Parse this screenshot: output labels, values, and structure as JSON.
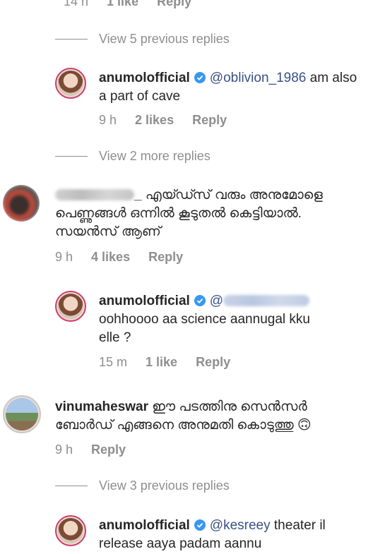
{
  "top_meta": {
    "time": "14 h",
    "likes": "1 like",
    "reply": "Reply"
  },
  "view_rows": {
    "r1": "View 5 previous replies",
    "r2": "View 2 more replies",
    "r3": "View 3 previous replies"
  },
  "comments": [
    {
      "username": "anumolofficial",
      "mention": "@oblivion_1986",
      "text": " am also a part of cave",
      "time": "9 h",
      "likes": "2 likes",
      "reply": "Reply"
    },
    {
      "username": "_",
      "text_l1": " എയ്ഡ്സ് വരും അനുമോളെ",
      "text_l2": "പെണ്ണുങ്ങൾ ഒന്നിൽ കൂടുതൽ കെട്ടിയാൽ.",
      "text_l3": "സയൻസ് ആണ്",
      "time": "9 h",
      "likes": "4 likes",
      "reply": "Reply"
    },
    {
      "username": "anumolofficial",
      "mention": "@",
      "text_l2": "oohhoooo aa science aannugal kku",
      "text_l3": "elle ?",
      "time": "15 m",
      "likes": "1 like",
      "reply": "Reply"
    },
    {
      "username": "vinumaheswar",
      "text_l1": " ഈ പടത്തിനു സെൻസർ",
      "text_l2": "ബോർഡ് എങ്ങനെ അനുമതി കൊടുത്തു 🙃",
      "time": "9 h",
      "reply": "Reply"
    },
    {
      "username": "anumolofficial",
      "mention": "@kesreey",
      "text_l1": " theater il",
      "text_l2": "release aaya padam aannu"
    }
  ],
  "colors": {
    "meta": "#8e8e8e",
    "mention": "#385185",
    "verified": "#3897f0",
    "ring": "#d23b6a"
  }
}
